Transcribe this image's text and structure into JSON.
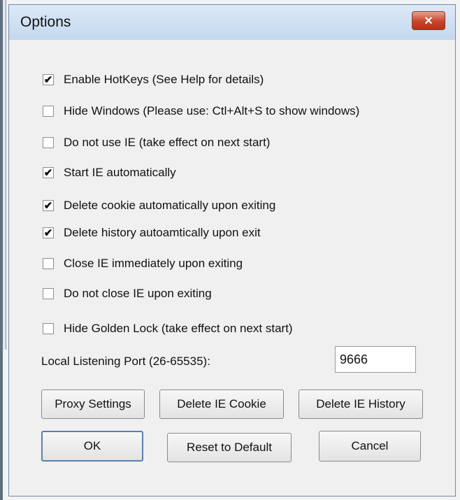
{
  "window": {
    "title": "Options",
    "close_icon": "close-icon"
  },
  "options": [
    {
      "label": "Enable HotKeys (See Help for details)",
      "checked": true
    },
    {
      "label": "Hide Windows (Please use: Ctl+Alt+S to show windows)",
      "checked": false
    },
    {
      "label": "Do not use IE (take effect on next start)",
      "checked": false
    },
    {
      "label": "Start IE automatically",
      "checked": true
    },
    {
      "label": "Delete cookie automatically upon exiting",
      "checked": true
    },
    {
      "label": "Delete history autoamtically upon exit",
      "checked": true
    },
    {
      "label": "Close IE immediately upon exiting",
      "checked": false
    },
    {
      "label": "Do not close IE upon exiting",
      "checked": false
    },
    {
      "label": "Hide Golden Lock (take effect on next start)",
      "checked": false
    }
  ],
  "port": {
    "label": "Local Listening Port (26-65535):",
    "value": "9666"
  },
  "buttons": {
    "proxy": "Proxy Settings",
    "delete_cookie": "Delete IE Cookie",
    "delete_history": "Delete IE History",
    "ok": "OK",
    "reset": "Reset to Default",
    "cancel": "Cancel"
  },
  "check_glyph": "✔"
}
